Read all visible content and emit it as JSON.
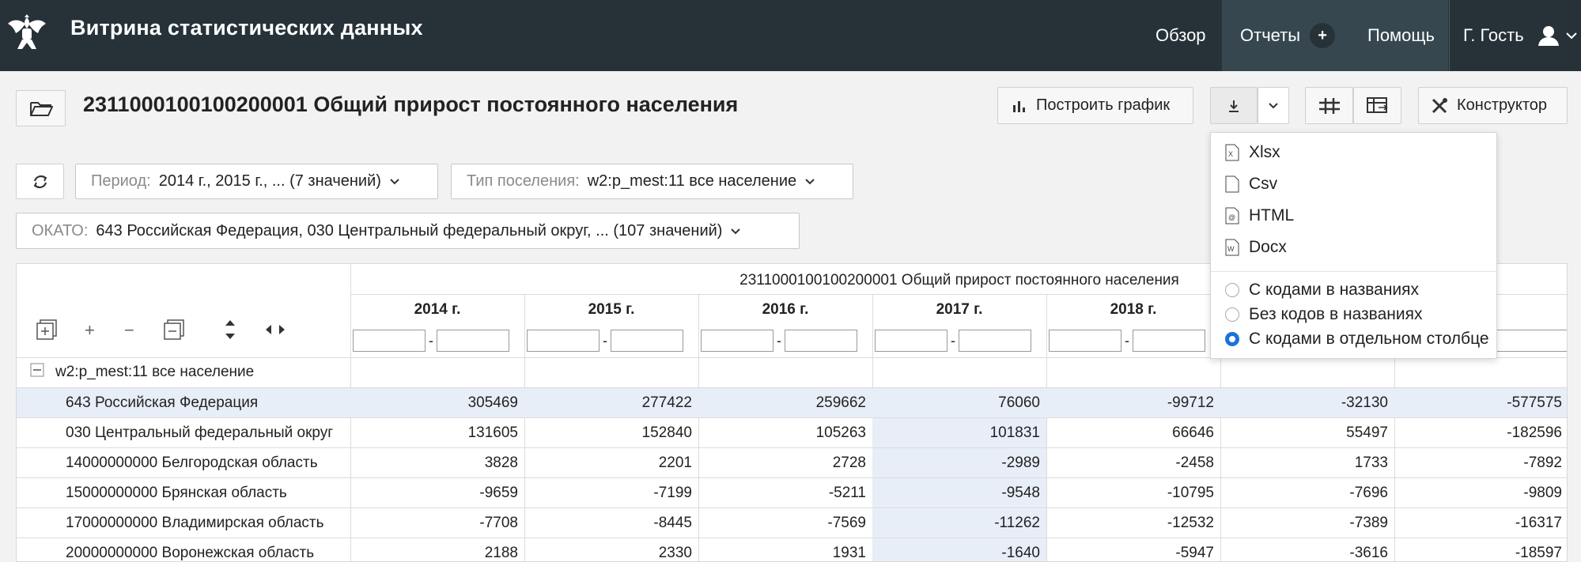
{
  "app": {
    "title": "Витрина статистических данных"
  },
  "nav": {
    "overview": "Обзор",
    "reports": "Отчеты",
    "plus": "+",
    "help": "Помощь",
    "user": "Г. Гость"
  },
  "toolbar": {
    "build_chart": "Построить график",
    "constructor": "Конструктор"
  },
  "page": {
    "title": "2311000100100200001 Общий прирост постоянного населения"
  },
  "filters": {
    "period_label": "Период:",
    "period_value": "2014 г., 2015 г., ... (7 значений)",
    "settlement_label": "Тип поселения:",
    "settlement_value": "w2:p_mest:11 все население",
    "okato_label": "ОКАТО:",
    "okato_value": "643 Российская Федерация, 030 Центральный федеральный округ, ... (107 значений)"
  },
  "export_menu": {
    "formats": [
      "Xlsx",
      "Csv",
      "HTML",
      "Docx"
    ],
    "options": [
      "С кодами в названиях",
      "Без кодов в названиях",
      "С кодами в отдельном столбце"
    ],
    "selected_option": 2
  },
  "table": {
    "header": "2311000100100200001 Общий прирост постоянного населения",
    "years": [
      "2014 г.",
      "2015 г.",
      "2016 г.",
      "2017 г.",
      "2018 г."
    ],
    "range_sep": "-",
    "tree_controls": {
      "plus": "+",
      "minus": "−"
    },
    "group": "w2:p_mest:11 все население",
    "group_toggle": "−",
    "rows": [
      {
        "name": "643 Российская Федерация",
        "values": [
          "305469",
          "277422",
          "259662",
          "76060",
          "-99712",
          "-32130",
          "-577575"
        ]
      },
      {
        "name": "030 Центральный федеральный округ",
        "values": [
          "131605",
          "152840",
          "105263",
          "101831",
          "66646",
          "55497",
          "-182596"
        ]
      },
      {
        "name": "14000000000 Белгородская область",
        "values": [
          "3828",
          "2201",
          "2728",
          "-2989",
          "-2458",
          "1733",
          "-7892"
        ]
      },
      {
        "name": "15000000000 Брянская область",
        "values": [
          "-9659",
          "-7199",
          "-5211",
          "-9548",
          "-10795",
          "-7696",
          "-9809"
        ]
      },
      {
        "name": "17000000000 Владимирская область",
        "values": [
          "-7708",
          "-8445",
          "-7569",
          "-11262",
          "-12532",
          "-7389",
          "-16317"
        ]
      },
      {
        "name": "20000000000 Воронежская область",
        "values": [
          "2188",
          "2330",
          "1931",
          "-1640",
          "-5947",
          "-3616",
          "-18597"
        ]
      }
    ]
  }
}
